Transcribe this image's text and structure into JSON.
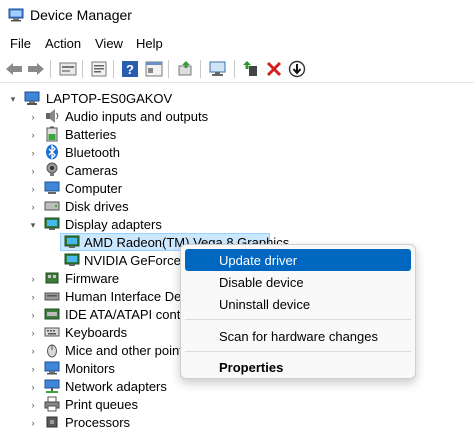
{
  "window": {
    "title": "Device Manager"
  },
  "menu": [
    "File",
    "Action",
    "View",
    "Help"
  ],
  "toolbar": {
    "buttons": [
      "back-icon",
      "forward-icon",
      "up-icon",
      "properties-icon",
      "help-icon",
      "view-icon",
      "hidden-devices-icon",
      "scan-icon",
      "add-driver-icon",
      "uninstall-icon",
      "disable-icon"
    ]
  },
  "tree": {
    "root": "LAPTOP-ES0GAKOV",
    "items": [
      "Audio inputs and outputs",
      "Batteries",
      "Bluetooth",
      "Cameras",
      "Computer",
      "Disk drives",
      "Display adapters",
      "AMD Radeon(TM) Vega 8 Graphics",
      "NVIDIA GeForce G",
      "Firmware",
      "Human Interface Devic",
      "IDE ATA/ATAPI controll",
      "Keyboards",
      "Mice and other pointi",
      "Monitors",
      "Network adapters",
      "Print queues",
      "Processors"
    ]
  },
  "context_menu": {
    "items": [
      "Update driver",
      "Disable device",
      "Uninstall device",
      "Scan for hardware changes",
      "Properties"
    ]
  },
  "colors": {
    "highlight": "#0067c0",
    "selection": "#cce8ff"
  }
}
